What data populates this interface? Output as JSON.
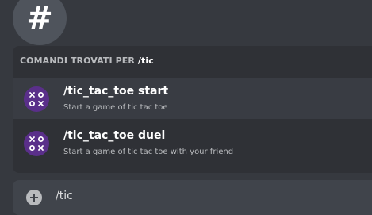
{
  "channel": {
    "icon_glyph": "#",
    "icon": "hash-icon"
  },
  "autocomplete": {
    "header_prefix": "COMANDI TROVATI PER ",
    "query": "/tic",
    "commands": [
      {
        "name": "/tic_tac_toe start",
        "description": "Start a game of tic tac toe",
        "icon": "tic-tac-toe-app-icon"
      },
      {
        "name": "/tic_tac_toe duel",
        "description": "Start a game of tic tac toe with your friend",
        "icon": "tic-tac-toe-app-icon"
      }
    ]
  },
  "composer": {
    "value": "/tic",
    "add_icon": "plus-circle-icon"
  },
  "colors": {
    "background": "#36393f",
    "popup": "#2f3136",
    "selected_row": "#393c43",
    "input": "#40444b",
    "app_icon": "#5a2f8a"
  }
}
